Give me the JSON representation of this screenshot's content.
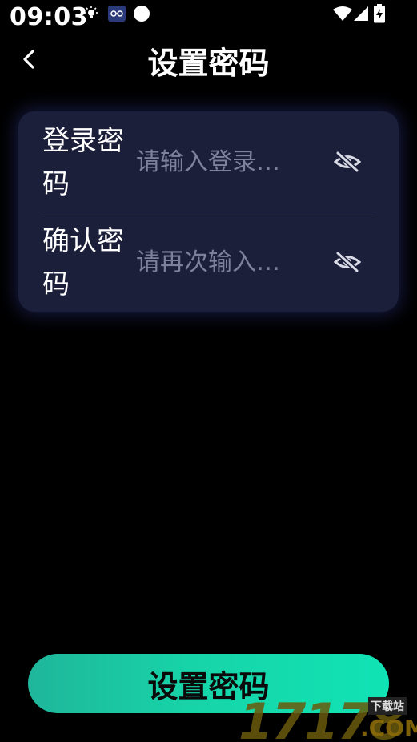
{
  "status_bar": {
    "time": "09:03",
    "icons": [
      "bulb-icon",
      "app-notification-icon",
      "circle-icon",
      "wifi-icon",
      "signal-icon",
      "battery-charging-icon"
    ]
  },
  "header": {
    "back_icon": "chevron-left-icon",
    "title": "设置密码"
  },
  "form": {
    "fields": [
      {
        "label": "登录密码",
        "value": "",
        "placeholder": "请输入登录…",
        "toggle_icon": "eye-off-icon"
      },
      {
        "label": "确认密码",
        "value": "",
        "placeholder": "请再次输入…",
        "toggle_icon": "eye-off-icon"
      }
    ]
  },
  "submit": {
    "label": "设置密码"
  },
  "watermark": {
    "digits": "17178",
    "domain": ".COM",
    "tag": "下载站"
  },
  "colors": {
    "background": "#000000",
    "card": "#1c1f3a",
    "placeholder": "#7d8199",
    "accent_start": "#1fb69b",
    "accent_end": "#10e3b5"
  }
}
